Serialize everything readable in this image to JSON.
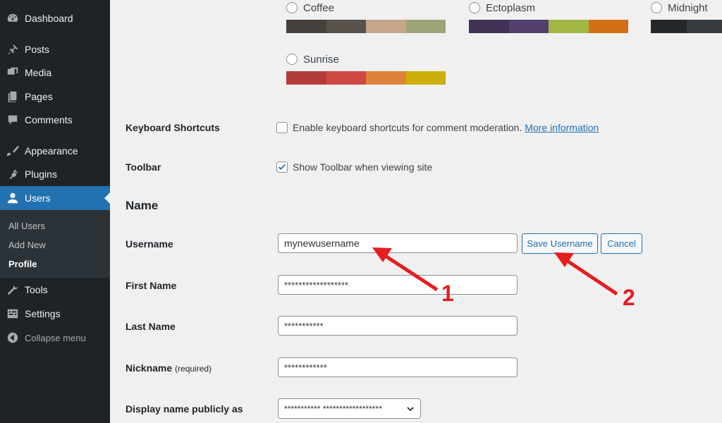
{
  "sidebar": {
    "items": [
      {
        "label": "Dashboard",
        "icon": "dashboard-icon"
      },
      {
        "label": "Posts",
        "icon": "pin-icon"
      },
      {
        "label": "Media",
        "icon": "media-icon"
      },
      {
        "label": "Pages",
        "icon": "pages-icon"
      },
      {
        "label": "Comments",
        "icon": "comment-icon"
      },
      {
        "label": "Appearance",
        "icon": "brush-icon"
      },
      {
        "label": "Plugins",
        "icon": "plug-icon"
      },
      {
        "label": "Users",
        "icon": "user-icon"
      },
      {
        "label": "Tools",
        "icon": "wrench-icon"
      },
      {
        "label": "Settings",
        "icon": "settings-icon"
      },
      {
        "label": "Collapse menu",
        "icon": "collapse-icon"
      }
    ],
    "submenu": [
      "All Users",
      "Add New",
      "Profile"
    ]
  },
  "color_schemes": [
    {
      "name": "Coffee",
      "colors": [
        "#46403c",
        "#59524c",
        "#c7a589",
        "#9ea476"
      ]
    },
    {
      "name": "Ectoplasm",
      "colors": [
        "#413256",
        "#523f6d",
        "#a3b745",
        "#d46f15"
      ]
    },
    {
      "name": "Midnight",
      "colors": [
        "#25282b",
        "#363b3f"
      ]
    },
    {
      "name": "Sunrise",
      "colors": [
        "#b43c38",
        "#cf4944",
        "#dd823b",
        "#ccaf0b"
      ]
    }
  ],
  "form": {
    "keyboard_shortcuts": {
      "label": "Keyboard Shortcuts",
      "text": "Enable keyboard shortcuts for comment moderation.",
      "link": "More information"
    },
    "toolbar": {
      "label": "Toolbar",
      "text": "Show Toolbar when viewing site"
    },
    "section_title": "Name",
    "username": {
      "label": "Username",
      "value": "mynewusername",
      "save_label": "Save Username",
      "cancel_label": "Cancel"
    },
    "first_name": {
      "label": "First Name",
      "value": "******************"
    },
    "last_name": {
      "label": "Last Name",
      "value": "***********"
    },
    "nickname": {
      "label": "Nickname",
      "required": "(required)",
      "value": "************"
    },
    "display_name": {
      "label": "Display name publicly as",
      "value": "*********** ******************"
    }
  },
  "annotations": {
    "one": "1",
    "two": "2",
    "color": "#e41e1e"
  }
}
